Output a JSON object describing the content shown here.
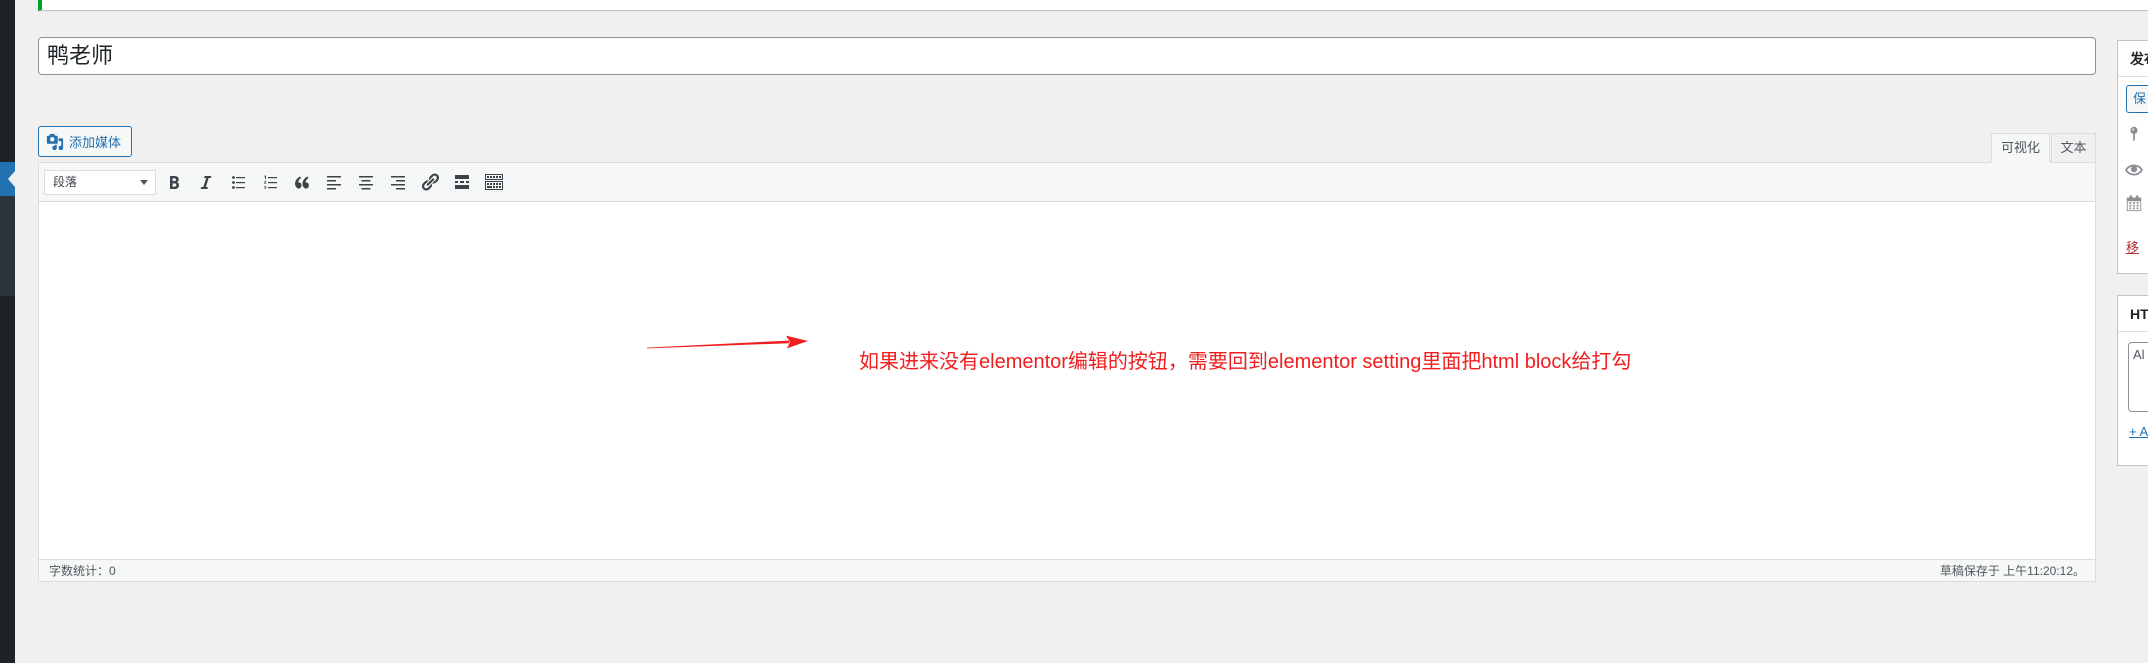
{
  "theme": {
    "admin_menu_bg": "#1d2327",
    "submenu_bg": "#2c3338",
    "accent": "#2271b1",
    "notice_success": "#00a32a",
    "trash_red": "#b32d2e"
  },
  "post": {
    "title": "鸭老师"
  },
  "media_button": {
    "label": "添加媒体",
    "icon": "admin-media-icon"
  },
  "editor_tabs": [
    {
      "label": "可视化",
      "active": true
    },
    {
      "label": "文本",
      "active": false
    }
  ],
  "toolbar": {
    "format_select": {
      "value": "段落"
    },
    "buttons": [
      "bold-icon",
      "italic-icon",
      "bulleted-list-icon",
      "numbered-list-icon",
      "blockquote-icon",
      "align-left-icon",
      "align-center-icon",
      "align-right-icon",
      "link-icon",
      "read-more-icon",
      "toolbar-toggle-icon"
    ]
  },
  "annotation": {
    "text": "如果进来没有elementor编辑的按钮，需要回到elementor setting里面把html block给打勾",
    "color": "#f01e1e",
    "arrow_icon": "red-arrow-icon"
  },
  "status_bar": {
    "word_count": "字数统计：0",
    "autosave": "草稿保存于 上午11:20:12。"
  },
  "sidebar": {
    "publish_box": {
      "title": "发布",
      "save_draft_label": "保",
      "icons": [
        "pin-icon",
        "eye-icon",
        "calendar-icon"
      ],
      "trash_link": "移"
    },
    "html_box": {
      "title": "HT",
      "textarea_value": "Al",
      "add_link": "+ A"
    }
  }
}
